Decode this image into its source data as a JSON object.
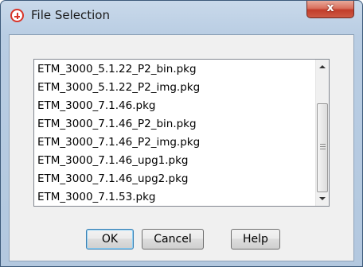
{
  "window": {
    "title": "File Selection",
    "close_label": "x",
    "icon": "app-logo-icon"
  },
  "file_list": {
    "items": [
      "ETM_3000_5.1.22_P2_bin.pkg",
      "ETM_3000_5.1.22_P2_img.pkg",
      "ETM_3000_7.1.46.pkg",
      "ETM_3000_7.1.46_P2_bin.pkg",
      "ETM_3000_7.1.46_P2_img.pkg",
      "ETM_3000_7.1.46_upg1.pkg",
      "ETM_3000_7.1.46_upg2.pkg",
      "ETM_3000_7.1.53.pkg"
    ]
  },
  "buttons": {
    "ok": "OK",
    "cancel": "Cancel",
    "help": "Help"
  },
  "colors": {
    "title_bar": "#c9d9ea",
    "close_button": "#c23d2a",
    "dialog_background": "#f0f0f0",
    "default_button_border": "#3c7fb1"
  }
}
